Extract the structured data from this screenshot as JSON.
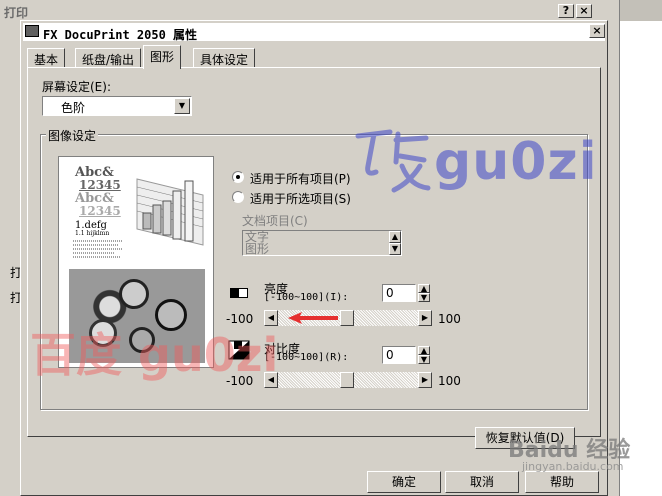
{
  "background_window": {
    "title": "打印",
    "left_labels": [
      "打",
      "打"
    ]
  },
  "dialog": {
    "title": "FX DocuPrint 2050 属性",
    "close": "×"
  },
  "tabs": [
    "基本",
    "纸盘/输出",
    "图形",
    "具体设定"
  ],
  "screen_setting": {
    "label": "屏幕设定(E):",
    "value": "色阶"
  },
  "image_group": {
    "label": "图像设定",
    "radio_all": "适用于所有项目(P)",
    "radio_selected": "适用于所选项目(S)",
    "doc_items_label": "文档项目(C)",
    "doc_items": [
      "文字",
      "图形"
    ],
    "preview": {
      "line1": "Abc&",
      "line2": "12345",
      "line3": "Abc&",
      "line4": "12345",
      "line5": "1.defg",
      "line6": "1.1 hijklmn"
    },
    "brightness": {
      "label": "亮度",
      "range": "[-100~100](I):",
      "value": "0",
      "min": "-100",
      "max": "100",
      "level": 0
    },
    "contrast": {
      "label": "对比度",
      "range": "[-100~100](R):",
      "value": "0",
      "min": "-100",
      "max": "100",
      "level": 0
    }
  },
  "buttons": {
    "restore": "恢复默认值(D)",
    "ok": "确定",
    "cancel": "取消",
    "help": "帮助"
  },
  "watermarks": {
    "center": "gu0zi",
    "bottom_left": "百度 gu0zi",
    "logo": "Baidu 经验",
    "site": "jingyan.baidu.com"
  },
  "colors": {
    "dialog_bg": "#d4d0c8",
    "arrow": "#e53030"
  }
}
